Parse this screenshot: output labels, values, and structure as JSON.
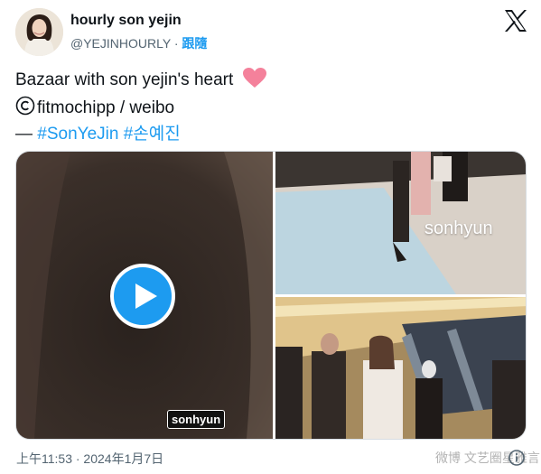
{
  "header": {
    "display_name": "hourly son yejin",
    "handle": "@YEJINHOURLY",
    "separator": "·",
    "follow_label": "跟隨"
  },
  "tweet": {
    "line1": "Bazaar with son yejin's heart",
    "line2": "fitmochipp / weibo",
    "line3_prefix": "— ",
    "hashtag1": "#SonYeJin",
    "hashtag2": "#손예진"
  },
  "media": {
    "video_watermark": "sonhyun",
    "photo_watermark": "sonhyun"
  },
  "footer": {
    "timestamp": "上午11:53 · 2024年1月7日",
    "weibo_watermark": "微博 文艺圈星雅言"
  },
  "icons": {
    "logo": "x-logo-icon",
    "heart": "heart-icon",
    "copyright": "copyright-icon",
    "play": "play-icon",
    "info": "info-icon"
  },
  "colors": {
    "link": "#1d9bf0",
    "heart": "#f4819b",
    "muted": "#536471"
  }
}
